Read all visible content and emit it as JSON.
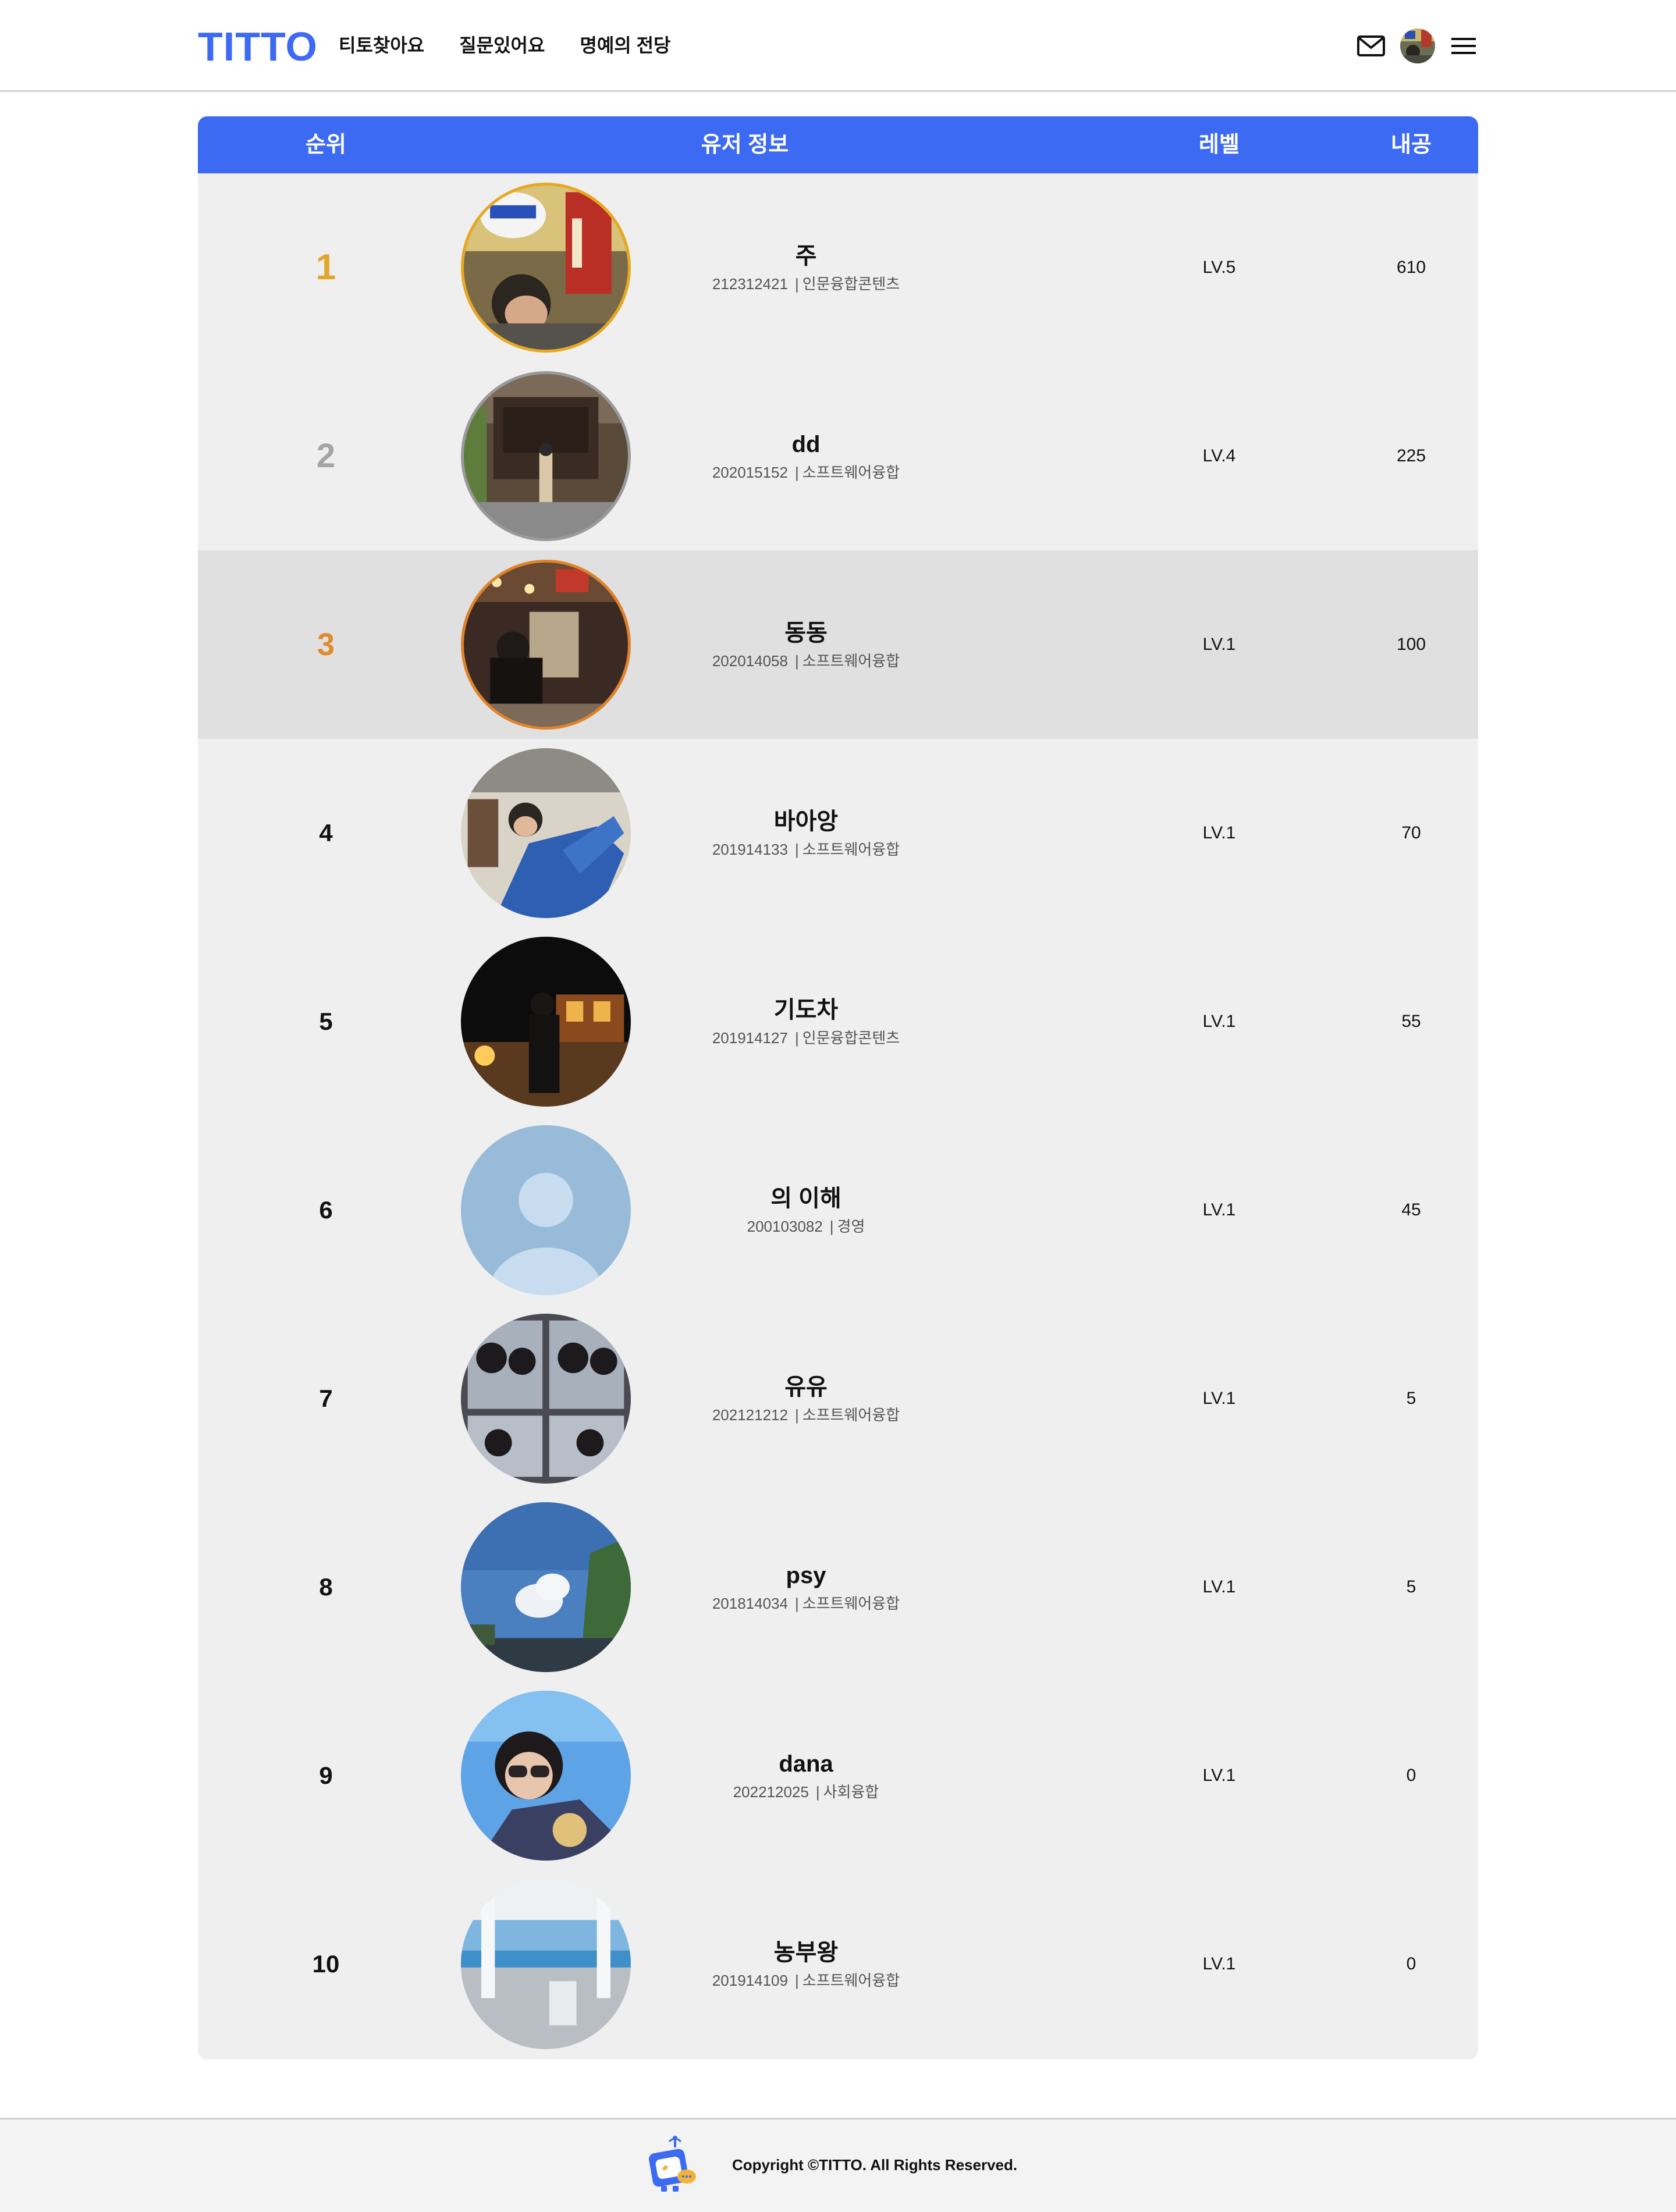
{
  "header": {
    "logo": "TITTO",
    "nav": [
      "티토찾아요",
      "질문있어요",
      "명예의 전당"
    ]
  },
  "table": {
    "columns": {
      "rank": "순위",
      "user": "유저 정보",
      "level": "레벨",
      "points": "내공"
    },
    "rows": [
      {
        "rank": "1",
        "name": "주",
        "student_id": "212312421",
        "major": "인문융합콘텐츠",
        "level": "LV.5",
        "points": "610"
      },
      {
        "rank": "2",
        "name": "dd",
        "student_id": "202015152",
        "major": "소프트웨어융합",
        "level": "LV.4",
        "points": "225"
      },
      {
        "rank": "3",
        "name": "동동",
        "student_id": "202014058",
        "major": "소프트웨어융합",
        "level": "LV.1",
        "points": "100"
      },
      {
        "rank": "4",
        "name": "바아앙",
        "student_id": "201914133",
        "major": "소프트웨어융합",
        "level": "LV.1",
        "points": "70"
      },
      {
        "rank": "5",
        "name": "기도차",
        "student_id": "201914127",
        "major": "인문융합콘텐츠",
        "level": "LV.1",
        "points": "55"
      },
      {
        "rank": "6",
        "name": "의 이해",
        "student_id": "200103082",
        "major": "경영",
        "level": "LV.1",
        "points": "45"
      },
      {
        "rank": "7",
        "name": "유유",
        "student_id": "202121212",
        "major": "소프트웨어융합",
        "level": "LV.1",
        "points": "5"
      },
      {
        "rank": "8",
        "name": "psy",
        "student_id": "201814034",
        "major": "소프트웨어융합",
        "level": "LV.1",
        "points": "5"
      },
      {
        "rank": "9",
        "name": "dana",
        "student_id": "202212025",
        "major": "사회융합",
        "level": "LV.1",
        "points": "0"
      },
      {
        "rank": "10",
        "name": "농부왕",
        "student_id": "201914109",
        "major": "소프트웨어융합",
        "level": "LV.1",
        "points": "0"
      }
    ]
  },
  "footer": {
    "copyright": "Copyright ©TITTO. All Rights Reserved."
  },
  "colors": {
    "brand": "#3d6af2",
    "gold": "#e3a52a",
    "silver": "#a4a4a4",
    "bronze": "#e08a30",
    "table_bg": "#efefef",
    "highlight_row": "#e0e0e0"
  },
  "icons": [
    "mail-icon",
    "menu-icon",
    "default-avatar-icon",
    "titto-mascot-logo"
  ]
}
